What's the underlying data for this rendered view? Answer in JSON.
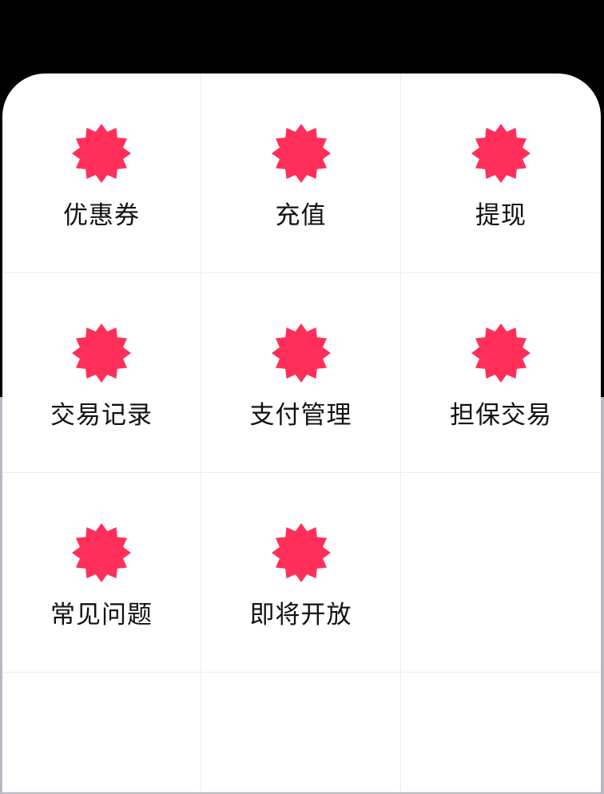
{
  "theme": {
    "icon_color": "#ff2f5a",
    "grid_line_color": "#ececf0",
    "sheet_color": "#ffffff"
  },
  "grid": {
    "items": [
      {
        "label": "优惠券",
        "icon": "badge-icon"
      },
      {
        "label": "充值",
        "icon": "badge-icon"
      },
      {
        "label": "提现",
        "icon": "badge-icon"
      },
      {
        "label": "交易记录",
        "icon": "badge-icon"
      },
      {
        "label": "支付管理",
        "icon": "badge-icon"
      },
      {
        "label": "担保交易",
        "icon": "badge-icon"
      },
      {
        "label": "常见问题",
        "icon": "badge-icon"
      },
      {
        "label": "即将开放",
        "icon": "badge-icon"
      }
    ]
  }
}
